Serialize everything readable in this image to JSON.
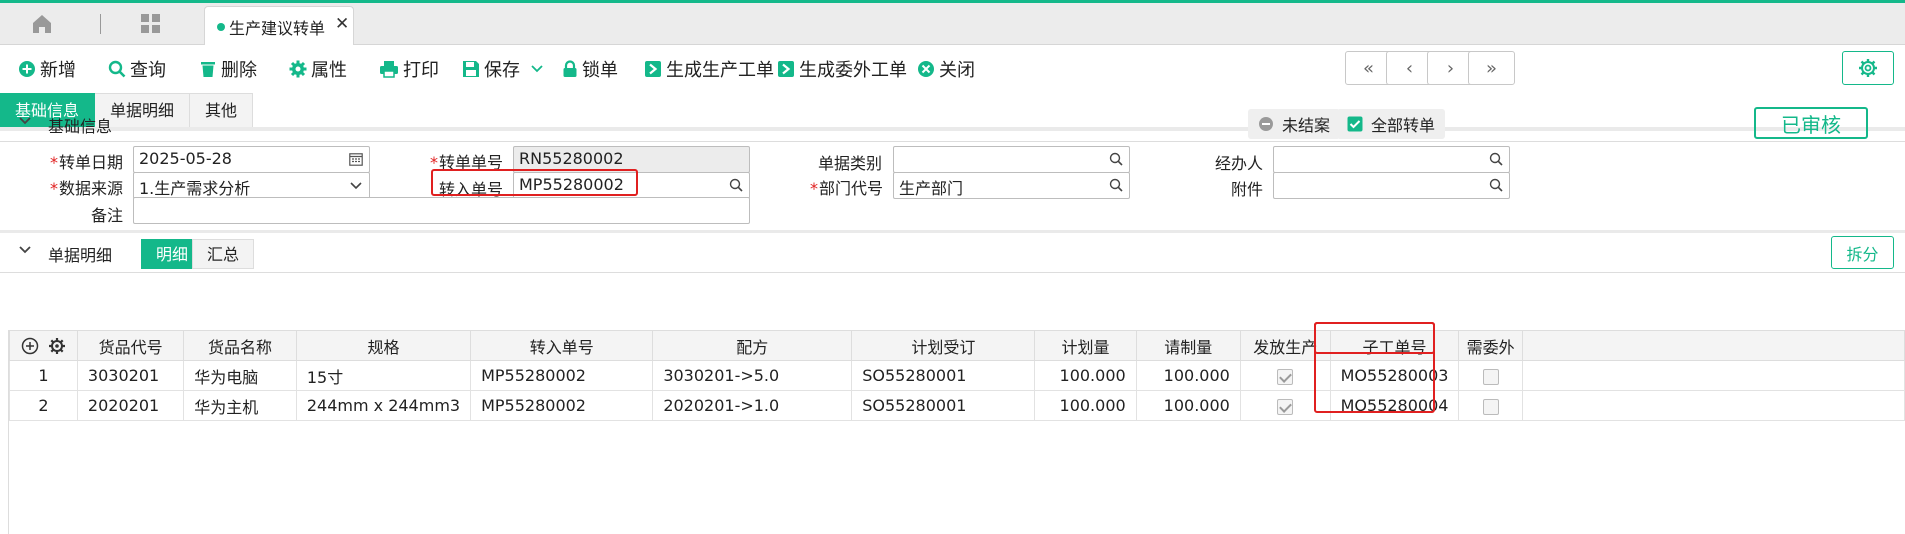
{
  "window": {
    "tab_title": "生产建议转单"
  },
  "toolbar": {
    "new": "新增",
    "query": "查询",
    "delete": "删除",
    "properties": "属性",
    "print": "打印",
    "save": "保存",
    "lock": "锁单",
    "gen_production": "生成生产工单",
    "gen_outsource": "生成委外工单",
    "close": "关闭",
    "nav": [
      "«",
      "‹",
      "›",
      "»"
    ]
  },
  "subtabs": [
    "基础信息",
    "单据明细",
    "其他"
  ],
  "basic": {
    "section_title": "基础信息",
    "status_unclosed": "未结案",
    "status_all_transferred": "全部转单",
    "approved_label": "已审核",
    "fields": {
      "transfer_date_label": "转单日期",
      "transfer_date": "2025-05-28",
      "data_source_label": "数据来源",
      "data_source": "1.生产需求分析",
      "remark_label": "备注",
      "remark": "",
      "transfer_no_label": "转单单号",
      "transfer_no": "RN55280002",
      "input_no_label": "转入单号",
      "input_no": "MP55280002",
      "doc_type_label": "单据类别",
      "doc_type": "",
      "dept_code_label": "部门代号",
      "dept_code": "生产部门",
      "handler_label": "经办人",
      "handler": "",
      "attachment_label": "附件",
      "attachment": ""
    }
  },
  "detail": {
    "section_title": "单据明细",
    "tab_detail": "明细",
    "tab_summary": "汇总",
    "split_button": "拆分",
    "columns": [
      "货品代号",
      "货品名称",
      "规格",
      "转入单号",
      "配方",
      "计划受订",
      "计划量",
      "请制量",
      "发放生产",
      "子工单号",
      "需委外"
    ],
    "rows": [
      {
        "idx": "1",
        "code": "3030201",
        "name": "华为电脑",
        "spec": "15寸",
        "input_no": "MP55280002",
        "formula": "3030201->5.0",
        "plan_order": "SO55280001",
        "plan_qty": "100.000",
        "req_qty": "100.000",
        "released": true,
        "sub_no": "MO55280003",
        "outsource": false
      },
      {
        "idx": "2",
        "code": "2020201",
        "name": "华为主机",
        "spec": "244mm x 244mm3",
        "input_no": "MP55280002",
        "formula": "2020201->1.0",
        "plan_order": "SO55280001",
        "plan_qty": "100.000",
        "req_qty": "100.000",
        "released": true,
        "sub_no": "MO55280004",
        "outsource": false
      }
    ]
  },
  "colors": {
    "accent": "#14b88a",
    "highlight": "#e02020"
  }
}
